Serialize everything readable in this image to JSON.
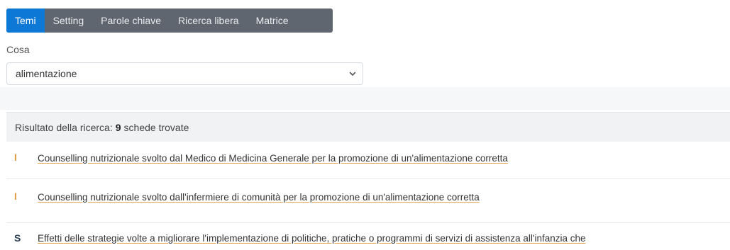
{
  "tabs": [
    {
      "label": "Temi",
      "active": true
    },
    {
      "label": "Setting",
      "active": false
    },
    {
      "label": "Parole chiave",
      "active": false
    },
    {
      "label": "Ricerca libera",
      "active": false
    },
    {
      "label": "Matrice",
      "active": false
    }
  ],
  "filter": {
    "label": "Cosa",
    "selected": "alimentazione",
    "icon": "chevron-down-icon"
  },
  "results": {
    "prefix": "Risultato della ricerca:",
    "count": "9",
    "suffix": "schede trovate"
  },
  "items": [
    {
      "marker": "I",
      "title": "Counselling nutrizionale svolto dal Medico di Medicina Generale per la promozione di un'alimentazione corretta"
    },
    {
      "marker": "I",
      "title": "Counselling nutrizionale svolto dall'infermiere di comunità per la promozione di un'alimentazione corretta"
    },
    {
      "marker": "S",
      "title": "Effetti delle strategie volte a migliorare l'implementazione di politiche, pratiche o programmi di servizi di assistenza all'infanzia che"
    }
  ],
  "colors": {
    "tab_active": "#0d78d6",
    "tabs_bg": "#5f6670",
    "marker_i": "#e09b3d",
    "marker_s": "#2a3d57"
  }
}
